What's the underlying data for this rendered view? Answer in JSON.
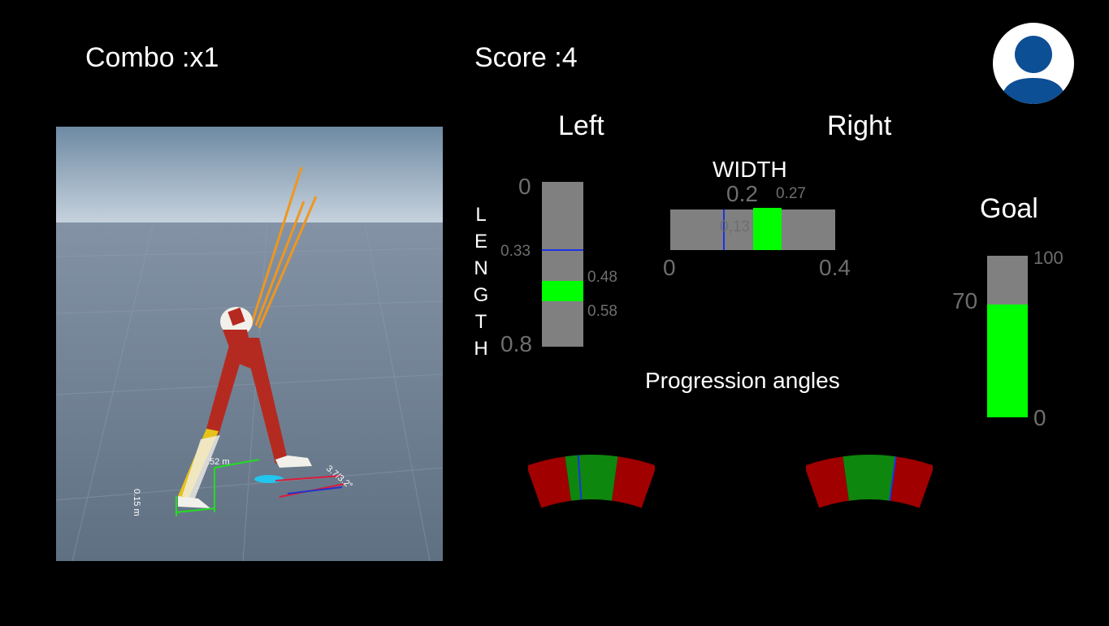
{
  "hud": {
    "combo": "Combo :x1",
    "score": "Score :4"
  },
  "viewport": {
    "labels": {
      "step_length": ".52 m",
      "width": "0.15 m",
      "angle": "3.7/3.2°"
    },
    "colors": {
      "sky": "#8aa2b6",
      "floor": "#6d7f93",
      "muscle": "#b52a20",
      "bone": "#f2f0ea",
      "force": "#f0961e"
    }
  },
  "headers": {
    "left": "Left",
    "right": "Right",
    "width": "WIDTH",
    "goal": "Goal",
    "progression": "Progression angles"
  },
  "length": {
    "axis_label": [
      "L",
      "E",
      "N",
      "G",
      "T",
      "H"
    ],
    "min_label": "0",
    "max_label": "0.8",
    "min": 0,
    "max": 0.8,
    "target_low": 0.48,
    "target_high": 0.58,
    "target_low_label": "0.48",
    "target_high_label": "0.58",
    "current": 0.33,
    "current_label": "0.33"
  },
  "width": {
    "min_label": "0",
    "max_label": "0.4",
    "mid_label": "0.2",
    "min": 0,
    "max": 0.4,
    "target_low": 0.2,
    "target_high": 0.27,
    "target_high_label": "0.27",
    "current": 0.13,
    "current_label": "0,13"
  },
  "goal": {
    "min_label": "0",
    "max_label": "100",
    "target_label": "70",
    "value": 70
  },
  "progression": {
    "left": {
      "needle_fraction": 0.4
    },
    "right": {
      "needle_fraction": 0.7
    },
    "colors": {
      "ok": "#0e870e",
      "bad": "#a00000",
      "needle": "#1a33e6"
    }
  },
  "avatar": {
    "icon": "user-profile-icon",
    "color": "#0d4f94"
  }
}
